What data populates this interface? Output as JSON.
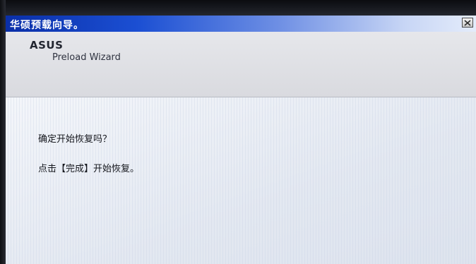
{
  "window": {
    "title": "华硕预载向导。",
    "close_icon": "close-icon"
  },
  "header": {
    "brand": "ASUS",
    "subtitle": "Preload Wizard"
  },
  "content": {
    "question": "确定开始恢复吗？",
    "instruction": "点击【完成】开始恢复。"
  },
  "colors": {
    "titlebar_start": "#0a2fa8",
    "titlebar_end": "#e4ecfb",
    "header_bg": "#e6e7eb",
    "content_bg": "#eef1f6"
  }
}
